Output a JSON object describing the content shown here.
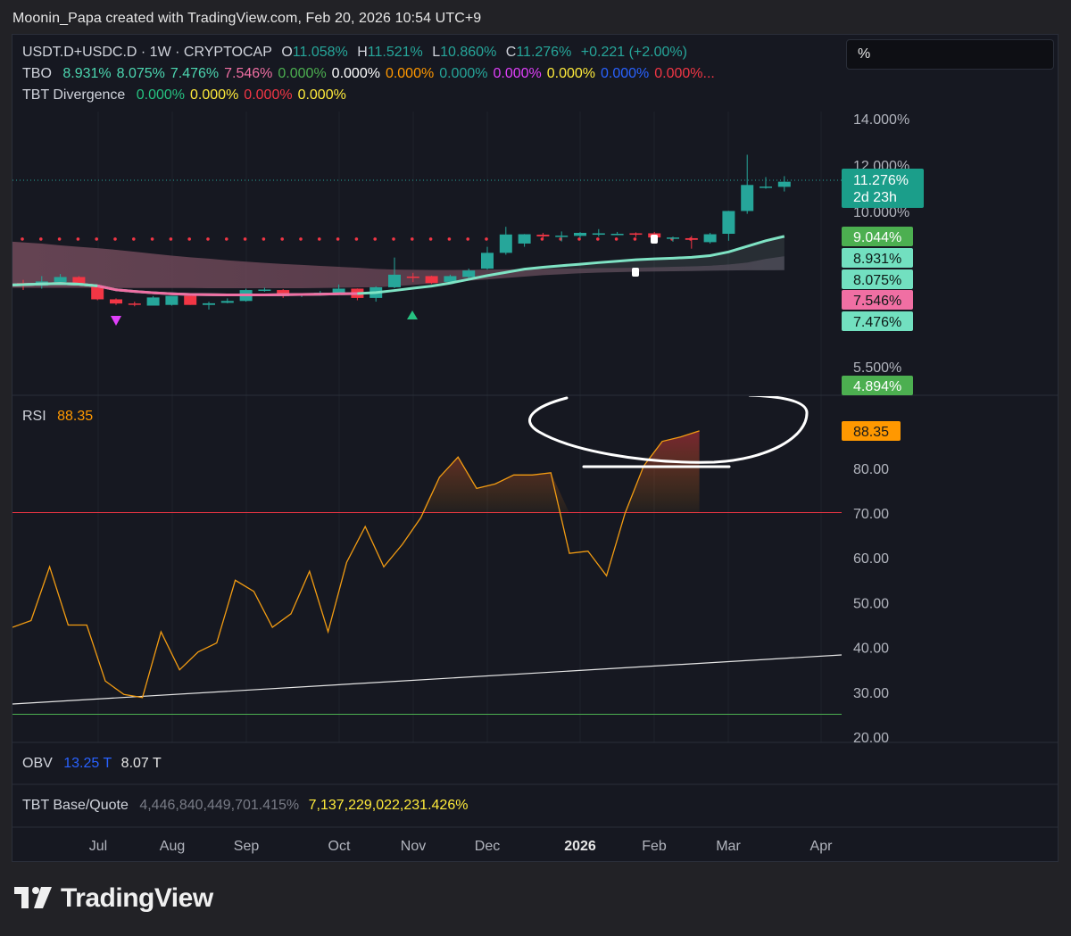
{
  "header": {
    "credit": "Moonin_Papa created with TradingView.com, Feb 20, 2026 10:54 UTC+9"
  },
  "toolbar": {
    "percent_button": "%"
  },
  "legend": {
    "symbol": "USDT.D+USDC.D · 1W · CRYPTOCAP",
    "o_label": "O",
    "o_val": "11.058%",
    "h_label": "H",
    "h_val": "11.521%",
    "l_label": "L",
    "l_val": "10.860%",
    "c_label": "C",
    "c_val": "11.276%",
    "change": "+0.221 (+2.00%)",
    "tbo_label": "TBO",
    "tbo_values": [
      {
        "text": "8.931%",
        "color": "#4cd6b0"
      },
      {
        "text": "8.075%",
        "color": "#4cd6b0"
      },
      {
        "text": "7.476%",
        "color": "#4cd6b0"
      },
      {
        "text": "7.546%",
        "color": "#f06fa3"
      },
      {
        "text": "0.000%",
        "color": "#4caf50"
      },
      {
        "text": "0.000%",
        "color": "#ffffff"
      },
      {
        "text": "0.000%",
        "color": "#ff9800"
      },
      {
        "text": "0.000%",
        "color": "#26a69a"
      },
      {
        "text": "0.000%",
        "color": "#e040fb"
      },
      {
        "text": "0.000%",
        "color": "#ffeb3b"
      },
      {
        "text": "0.000%",
        "color": "#2962ff"
      },
      {
        "text": "0.000%...",
        "color": "#f23645"
      }
    ],
    "tbt_label": "TBT Divergence",
    "tbt_values": [
      {
        "text": "0.000%",
        "color": "#26c281"
      },
      {
        "text": "0.000%",
        "color": "#ffeb3b"
      },
      {
        "text": "0.000%",
        "color": "#f23645"
      },
      {
        "text": "0.000%",
        "color": "#ffeb3b"
      }
    ],
    "rsi_label": "RSI",
    "rsi_value": "88.35",
    "obv_label": "OBV",
    "obv_v1": "13.25 T",
    "obv_v2": "8.07 T",
    "bq_label": "TBT Base/Quote",
    "bq_v1": "4,446,840,449,701.415%",
    "bq_v2": "7,137,229,022,231.426%"
  },
  "chart_data": [
    {
      "type": "candlestick",
      "title": "USDT.D+USDC.D · 1W · CRYPTOCAP",
      "y_axis": {
        "ticks": [
          "14.000%",
          "12.000%",
          "10.000%",
          "5.500%"
        ],
        "tick_values": [
          14.0,
          12.0,
          10.0,
          5.5
        ]
      },
      "last_price": {
        "value": "11.276%",
        "countdown": "2d 23h"
      },
      "axis_badges": [
        {
          "text": "9.044%",
          "value": 9.044,
          "color": "#4caf50"
        },
        {
          "text": "8.931%",
          "value": 8.931,
          "color": "#72e0c0"
        },
        {
          "text": "8.075%",
          "value": 8.075,
          "color": "#72e0c0"
        },
        {
          "text": "7.546%",
          "value": 7.546,
          "color": "#f06fa3"
        },
        {
          "text": "7.476%",
          "value": 7.476,
          "color": "#72e0c0"
        },
        {
          "text": "4.894%",
          "value": 4.894,
          "color": "#4caf50"
        }
      ],
      "candles": [
        {
          "o": 6.92,
          "h": 7.06,
          "c": 6.81,
          "l": 6.62
        },
        {
          "o": 6.81,
          "h": 7.22,
          "c": 6.99,
          "l": 6.68
        },
        {
          "o": 6.96,
          "h": 7.31,
          "c": 7.18,
          "l": 6.91
        },
        {
          "o": 7.18,
          "h": 7.22,
          "c": 6.82,
          "l": 6.82
        },
        {
          "o": 6.78,
          "h": 6.83,
          "c": 6.22,
          "l": 6.18
        },
        {
          "o": 6.22,
          "h": 6.26,
          "c": 6.04,
          "l": 5.98
        },
        {
          "o": 6.04,
          "h": 6.12,
          "c": 6.0,
          "l": 5.92
        },
        {
          "o": 5.95,
          "h": 6.36,
          "c": 6.3,
          "l": 5.95
        },
        {
          "o": 5.98,
          "h": 6.36,
          "c": 6.37,
          "l": 5.95
        },
        {
          "o": 6.37,
          "h": 6.42,
          "c": 5.98,
          "l": 5.98
        },
        {
          "o": 5.98,
          "h": 6.12,
          "c": 6.05,
          "l": 5.78
        },
        {
          "o": 6.07,
          "h": 6.26,
          "c": 6.15,
          "l": 6.05
        },
        {
          "o": 6.15,
          "h": 6.68,
          "c": 6.62,
          "l": 6.12
        },
        {
          "o": 6.62,
          "h": 6.72,
          "c": 6.64,
          "l": 6.55
        },
        {
          "o": 6.62,
          "h": 6.66,
          "c": 6.36,
          "l": 6.28
        },
        {
          "o": 6.38,
          "h": 6.45,
          "c": 6.46,
          "l": 6.32
        },
        {
          "o": 6.41,
          "h": 6.58,
          "c": 6.5,
          "l": 6.38
        },
        {
          "o": 6.5,
          "h": 6.86,
          "c": 6.68,
          "l": 6.43
        },
        {
          "o": 6.68,
          "h": 6.69,
          "c": 6.28,
          "l": 6.18
        },
        {
          "o": 6.28,
          "h": 6.78,
          "c": 6.74,
          "l": 6.12
        },
        {
          "o": 6.74,
          "h": 8.02,
          "c": 7.28,
          "l": 6.7
        },
        {
          "o": 7.2,
          "h": 7.36,
          "c": 7.14,
          "l": 6.96
        },
        {
          "o": 7.22,
          "h": 7.24,
          "c": 6.92,
          "l": 6.88
        },
        {
          "o": 6.97,
          "h": 7.28,
          "c": 7.22,
          "l": 6.93
        },
        {
          "o": 7.18,
          "h": 7.54,
          "c": 7.46,
          "l": 7.12
        },
        {
          "o": 7.54,
          "h": 8.48,
          "c": 8.22,
          "l": 7.5
        },
        {
          "o": 8.22,
          "h": 9.34,
          "c": 9.01,
          "l": 8.14
        },
        {
          "o": 8.62,
          "h": 9.03,
          "c": 9.02,
          "l": 8.48
        },
        {
          "o": 9.0,
          "h": 9.08,
          "c": 8.93,
          "l": 8.78
        },
        {
          "o": 8.92,
          "h": 9.14,
          "c": 8.96,
          "l": 8.71
        },
        {
          "o": 8.95,
          "h": 9.11,
          "c": 9.08,
          "l": 8.85
        },
        {
          "o": 9.0,
          "h": 9.24,
          "c": 9.06,
          "l": 8.92
        },
        {
          "o": 9.04,
          "h": 9.12,
          "c": 9.04,
          "l": 8.98
        },
        {
          "o": 9.06,
          "h": 9.1,
          "c": 9.0,
          "l": 8.9
        },
        {
          "o": 9.06,
          "h": 9.12,
          "c": 8.88,
          "l": 8.86
        },
        {
          "o": 8.88,
          "h": 8.92,
          "c": 8.88,
          "l": 8.7
        },
        {
          "o": 8.85,
          "h": 8.95,
          "c": 8.78,
          "l": 8.4
        },
        {
          "o": 8.68,
          "h": 9.08,
          "c": 9.02,
          "l": 8.62
        },
        {
          "o": 9.04,
          "h": 10.03,
          "c": 10.02,
          "l": 8.74
        },
        {
          "o": 10.02,
          "h": 12.44,
          "c": 11.14,
          "l": 9.9
        },
        {
          "o": 11.02,
          "h": 11.48,
          "c": 11.07,
          "l": 10.98
        },
        {
          "o": 11.06,
          "h": 11.52,
          "c": 11.28,
          "l": 10.86
        }
      ],
      "ma_fast": [
        6.84,
        6.88,
        6.9,
        6.87,
        6.8,
        6.63,
        6.56,
        6.5,
        6.46,
        6.43,
        6.42,
        6.41,
        6.41,
        6.41,
        6.42,
        6.43,
        6.44,
        6.46,
        6.47,
        6.51,
        6.6,
        6.7,
        6.79,
        6.92,
        7.08,
        7.24,
        7.38,
        7.52,
        7.6,
        7.67,
        7.73,
        7.8,
        7.86,
        7.92,
        7.96,
        7.99,
        8.03,
        8.1,
        8.26,
        8.5,
        8.74,
        8.93
      ],
      "ribbon_top": [
        8.7,
        8.62,
        8.54,
        8.48,
        8.42,
        8.35,
        8.27,
        8.18,
        8.1,
        8.03,
        7.97,
        7.9,
        7.84,
        7.79,
        7.74,
        7.7,
        7.66,
        7.62,
        7.58,
        7.53,
        7.5,
        7.49,
        7.48,
        7.48,
        7.49,
        7.5,
        7.51,
        7.52,
        7.53,
        7.54,
        7.55,
        7.56,
        7.57,
        7.58,
        7.6,
        7.62,
        7.64,
        7.67,
        7.72,
        7.8,
        7.96,
        8.075
      ],
      "ribbon_bottom": [
        6.72,
        6.72,
        6.72,
        6.72,
        6.72,
        6.71,
        6.71,
        6.71,
        6.71,
        6.71,
        6.7,
        6.7,
        6.7,
        6.7,
        6.7,
        6.7,
        6.71,
        6.72,
        6.73,
        6.74,
        6.78,
        6.84,
        6.9,
        6.96,
        7.02,
        7.08,
        7.14,
        7.2,
        7.26,
        7.3,
        7.34,
        7.37,
        7.39,
        7.41,
        7.42,
        7.43,
        7.44,
        7.45,
        7.46,
        7.47,
        7.47,
        7.476
      ],
      "dotted_resistance": 9.044
    },
    {
      "type": "line",
      "title": "RSI",
      "y_axis": {
        "ticks": [
          "80.00",
          "70.00",
          "60.00",
          "50.00",
          "40.00",
          "30.00",
          "20.00"
        ],
        "tick_values": [
          80,
          70,
          60,
          50,
          40,
          30,
          20
        ]
      },
      "last_value": "88.35",
      "levels": [
        {
          "value": 70,
          "color": "#f23645"
        },
        {
          "value": 25,
          "color": "#4caf50"
        }
      ],
      "values": [
        44.5,
        46,
        58,
        45,
        45,
        32.5,
        29.5,
        28.8,
        43.5,
        35,
        39,
        41,
        55,
        52.5,
        44.5,
        47.5,
        57,
        43.5,
        59,
        67,
        58,
        63,
        69,
        78,
        82.5,
        75.5,
        76.5,
        78.5,
        78.5,
        79,
        61,
        61.5,
        56,
        70,
        80.5,
        86,
        87,
        88.35
      ],
      "trendline": {
        "start": 27,
        "end": 38
      }
    }
  ],
  "x_axis": [
    "Jul",
    "Aug",
    "Sep",
    "Oct",
    "Nov",
    "Dec",
    "2026",
    "Feb",
    "Mar",
    "Apr"
  ],
  "brand": "TradingView"
}
